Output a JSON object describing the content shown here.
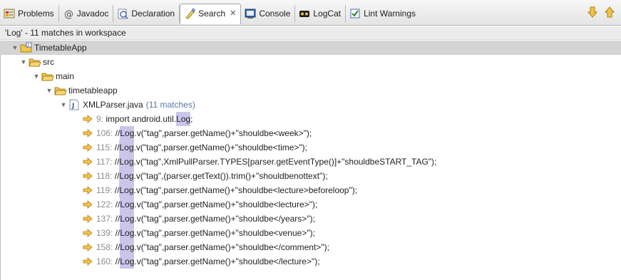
{
  "tabs": [
    {
      "label": "Problems",
      "icon": "problems-icon"
    },
    {
      "label": "Javadoc",
      "icon": "javadoc-icon"
    },
    {
      "label": "Declaration",
      "icon": "declaration-icon"
    },
    {
      "label": "Search",
      "icon": "search-icon",
      "active": true,
      "close": "✕"
    },
    {
      "label": "Console",
      "icon": "console-icon"
    },
    {
      "label": "LogCat",
      "icon": "logcat-icon"
    },
    {
      "label": "Lint Warnings",
      "icon": "lint-icon"
    }
  ],
  "view_actions": {
    "next": "next-match-icon",
    "previous": "previous-match-icon"
  },
  "summary": "'Log' - 11 matches in workspace",
  "tree": {
    "project": "TimetableApp",
    "src": "src",
    "main": "main",
    "package": "timetableapp",
    "file": "XMLParser.java",
    "file_matches": "(11 matches)",
    "matches": [
      {
        "line": "9:",
        "pre": " import android.util.",
        "hit": "Log",
        "post": ";"
      },
      {
        "line": "106:",
        "pre": " //",
        "hit": "Log",
        "post": ".v(\"tag\",parser.getName()+\"shouldbe<week>\");"
      },
      {
        "line": "115:",
        "pre": " //",
        "hit": "Log",
        "post": ".v(\"tag\",parser.getName()+\"shouldbe<time>\");"
      },
      {
        "line": "117:",
        "pre": " //",
        "hit": "Log",
        "post": ".v(\"tag\",XmlPullParser.TYPES[parser.getEventType()]+\"shouldbeSTART_TAG\");"
      },
      {
        "line": "118:",
        "pre": " //",
        "hit": "Log",
        "post": ".v(\"tag\",(parser.getText()).trim()+\"shouldbenottext\");"
      },
      {
        "line": "119:",
        "pre": " //",
        "hit": "Log",
        "post": ".v(\"tag\",parser.getName()+\"shouldbe<lecture>beforeloop\");"
      },
      {
        "line": "122:",
        "pre": " //",
        "hit": "Log",
        "post": ".v(\"tag\",parser.getName()+\"shouldbe<lecture>\");"
      },
      {
        "line": "137:",
        "pre": " //",
        "hit": "Log",
        "post": ".v(\"tag\",parser.getName()+\"shouldbe</years>\");"
      },
      {
        "line": "139:",
        "pre": " //",
        "hit": "Log",
        "post": ".v(\"tag\",parser.getName()+\"shouldbe<venue>\");"
      },
      {
        "line": "158:",
        "pre": " //",
        "hit": "Log",
        "post": ".v(\"tag\",parser.getName()+\"shouldbe</comment>\");"
      },
      {
        "line": "160:",
        "pre": " //",
        "hit": "Log",
        "post": ".v(\"tag\",parser.getName()+\"shouldbe</lecture>\");"
      }
    ]
  },
  "colors": {
    "highlight": "#c9c6ea",
    "match_count": "#5a75a8",
    "line_number": "#8c8c8c",
    "arrow": "#e0a526",
    "folder": "#f0c64a"
  }
}
